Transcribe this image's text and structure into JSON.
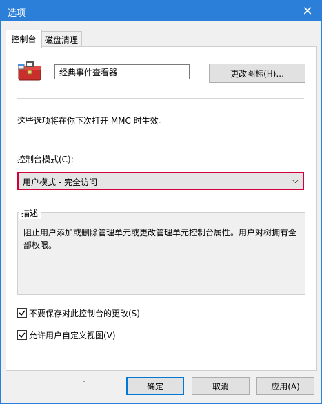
{
  "window": {
    "title": "选项",
    "close_symbol": "✕"
  },
  "tabs": [
    {
      "label": "控制台"
    },
    {
      "label": "磁盘清理"
    }
  ],
  "general": {
    "console_name": "经典事件查看器",
    "change_icon_button": "更改图标(H)..."
  },
  "info_text": "这些选项将在你下次打开 MMC 时生效。",
  "console_mode": {
    "label": "控制台模式(C):",
    "selected": "用户模式 - 完全访问",
    "caret": "⌵"
  },
  "description": {
    "title": "描述",
    "text": "阻止用户添加或删除管理单元或更改管理单元控制台属性。用户对树拥有全部权限。"
  },
  "options": [
    {
      "label": "不要保存对此控制台的更改(S)",
      "checked": true
    },
    {
      "label": "允许用户自定义视图(V)",
      "checked": true
    }
  ],
  "footer": {
    "ok": "确定",
    "cancel": "取消",
    "apply": "应用(A)"
  },
  "colors": {
    "titlebar": "#2b7fd8",
    "select_border": "#d1003a",
    "primary_button_border": "#0078d7"
  }
}
